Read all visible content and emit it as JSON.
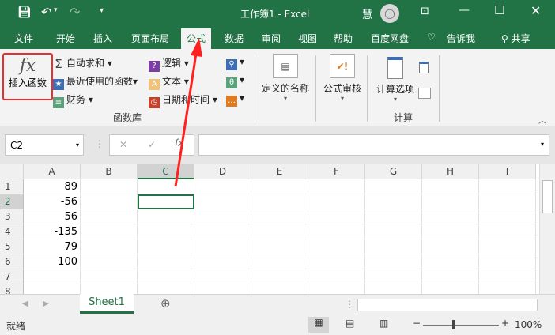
{
  "title_bar": {
    "title": "工作簿1  -  Excel",
    "user": "慧",
    "save_icon": "save-icon",
    "undo_icon": "undo-icon",
    "redo_icon": "redo-icon"
  },
  "tabs": [
    "文件",
    "开始",
    "插入",
    "页面布局",
    "公式",
    "数据",
    "审阅",
    "视图",
    "帮助",
    "百度网盘",
    "告诉我",
    "共享"
  ],
  "active_tab": "公式",
  "ribbon": {
    "insert_function": "插入函数",
    "autosum": "自动求和",
    "recent": "最近使用的函数",
    "financial": "财务",
    "logical": "逻辑",
    "text": "文本",
    "datetime": "日期和时间",
    "group_library": "函数库",
    "define_name": "定义的名称",
    "formula_audit": "公式审核",
    "calc_options": "计算选项",
    "group_calc": "计算"
  },
  "formula_bar": {
    "name_box": "C2",
    "fx": "fx",
    "value": ""
  },
  "columns": [
    "A",
    "B",
    "C",
    "D",
    "E",
    "F",
    "G",
    "H",
    "I"
  ],
  "rows": [
    "1",
    "2",
    "3",
    "4",
    "5",
    "6",
    "7",
    "8"
  ],
  "column_a_values": [
    "89",
    "-56",
    "56",
    "-135",
    "79",
    "100",
    "",
    ""
  ],
  "selected_cell": "C2",
  "sheet_tab": "Sheet1",
  "status": {
    "ready": "就绪",
    "zoom": "100%"
  },
  "colors": {
    "accent": "#217346",
    "annotation": "#ff2020"
  }
}
